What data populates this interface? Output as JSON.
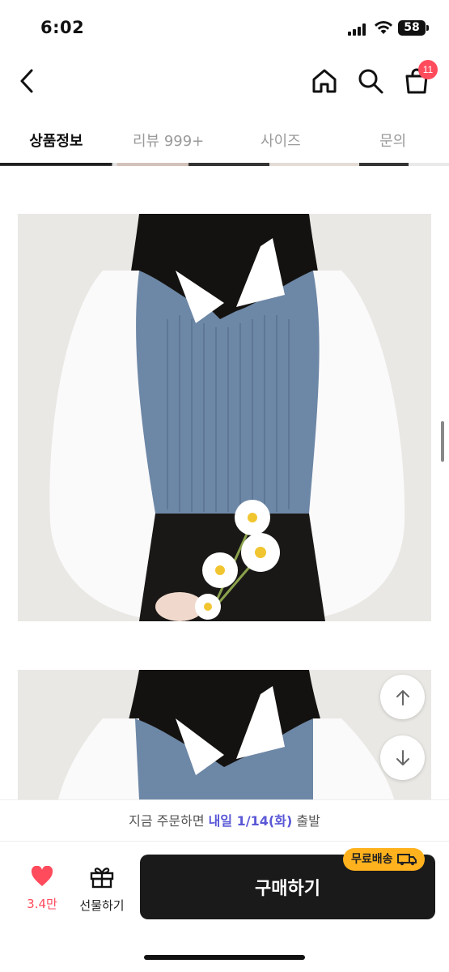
{
  "status_bar": {
    "time": "6:02",
    "battery": "58"
  },
  "header": {
    "cart_badge": "11"
  },
  "tabs": [
    {
      "label": "상품정보",
      "active": true
    },
    {
      "label": "리뷰 999+",
      "active": false
    },
    {
      "label": "사이즈",
      "active": false
    },
    {
      "label": "문의",
      "active": false
    }
  ],
  "delivery": {
    "prefix": "지금 주문하면 ",
    "highlight": "내일 1/14(화)",
    "suffix": " 출발"
  },
  "bottom_bar": {
    "like_count": "3.4만",
    "gift_label": "선물하기",
    "buy_label": "구매하기",
    "free_shipping_label": "무료배송"
  },
  "colors": {
    "accent": "#5a58d6",
    "like": "#ff4b5c",
    "badge": "#ff4b5c",
    "free_shipping": "#ffb21e",
    "buy_button": "#1a1a1a"
  },
  "icons": [
    "back-icon",
    "home-icon",
    "search-icon",
    "cart-icon",
    "arrow-up-icon",
    "arrow-down-icon",
    "heart-icon",
    "gift-icon",
    "truck-icon"
  ]
}
